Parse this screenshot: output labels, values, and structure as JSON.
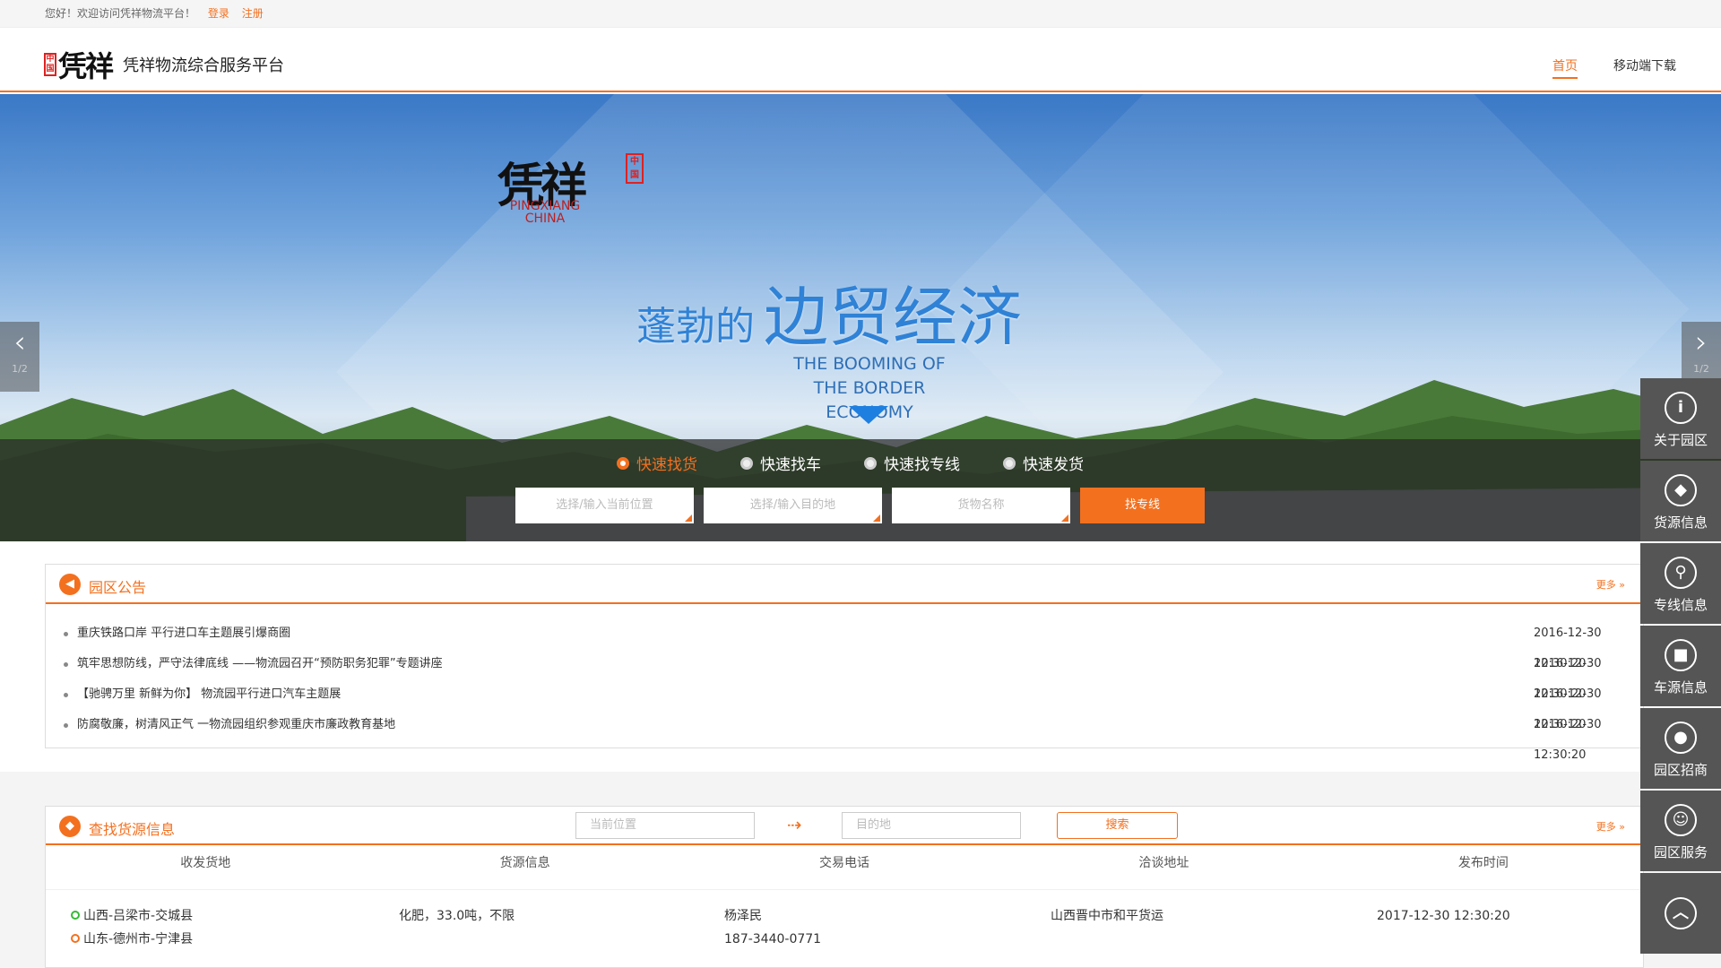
{
  "topbar": {
    "welcome": "您好！欢迎访问凭祥物流平台！",
    "login": "登录",
    "register": "注册"
  },
  "header": {
    "seal": "中国",
    "brand": "凭祥",
    "title": "凭祥物流综合服务平台",
    "nav": [
      {
        "label": "首页",
        "active": true
      },
      {
        "label": "移动端下载",
        "active": false
      }
    ]
  },
  "banner": {
    "logo_brand": "凭祥",
    "logo_seal": "中国",
    "logo_en": "PINGXIANG CHINA",
    "slogan_small": "蓬勃的",
    "slogan_big": "边贸经济",
    "slogan_en_1": "THE BOOMING OF",
    "slogan_en_2": "THE BORDER ECONOMY",
    "page_indicator": "1/2"
  },
  "search": {
    "tabs": [
      {
        "label": "快速找货",
        "active": true
      },
      {
        "label": "快速找车",
        "active": false
      },
      {
        "label": "快速找专线",
        "active": false
      },
      {
        "label": "快速发货",
        "active": false
      }
    ],
    "origin_placeholder": "选择/输入当前位置",
    "dest_placeholder": "选择/输入目的地",
    "goods_placeholder": "货物名称",
    "button": "找专线"
  },
  "notice": {
    "title": "园区公告",
    "more": "更多 »",
    "items": [
      {
        "text": "重庆铁路口岸 平行进口车主题展引爆商圈",
        "date": "2016-12-30 12:30:20"
      },
      {
        "text": "筑牢思想防线，严守法律底线 ——物流园召开“预防职务犯罪”专题讲座",
        "date": "2016-12-30 12:30:20"
      },
      {
        "text": "【驰骋万里 新鲜为你】 物流园平行进口汽车主题展",
        "date": "2016-12-30 12:30:20"
      },
      {
        "text": "防腐敬廉，树清风正气 一物流园组织参观重庆市廉政教育基地",
        "date": "2016-12-30 12:30:20"
      }
    ]
  },
  "cargo": {
    "title": "查找货源信息",
    "origin_placeholder": "当前位置",
    "dest_placeholder": "目的地",
    "button": "搜索",
    "more": "更多 »",
    "columns": [
      "收发货地",
      "货源信息",
      "交易电话",
      "洽谈地址",
      "发布时间"
    ],
    "row": {
      "from": "山西-吕梁市-交城县",
      "to": "山东-德州市-宁津县",
      "info": "化肥，33.0吨，不限",
      "contact": "杨泽民",
      "phone": "187-3440-0771",
      "address": "山西晋中市和平货运",
      "time": "2017-12-30 12:30:20"
    }
  },
  "sidebar": {
    "items": [
      {
        "label": "关于园区",
        "icon": "info-icon"
      },
      {
        "label": "货源信息",
        "icon": "box-icon"
      },
      {
        "label": "专线信息",
        "icon": "route-icon"
      },
      {
        "label": "车源信息",
        "icon": "truck-icon"
      },
      {
        "label": "园区招商",
        "icon": "user-icon"
      },
      {
        "label": "园区服务",
        "icon": "service-icon"
      }
    ],
    "top_icon": "arrow-up-icon"
  },
  "colors": {
    "accent": "#f3701f",
    "sidebar": "#555555"
  }
}
